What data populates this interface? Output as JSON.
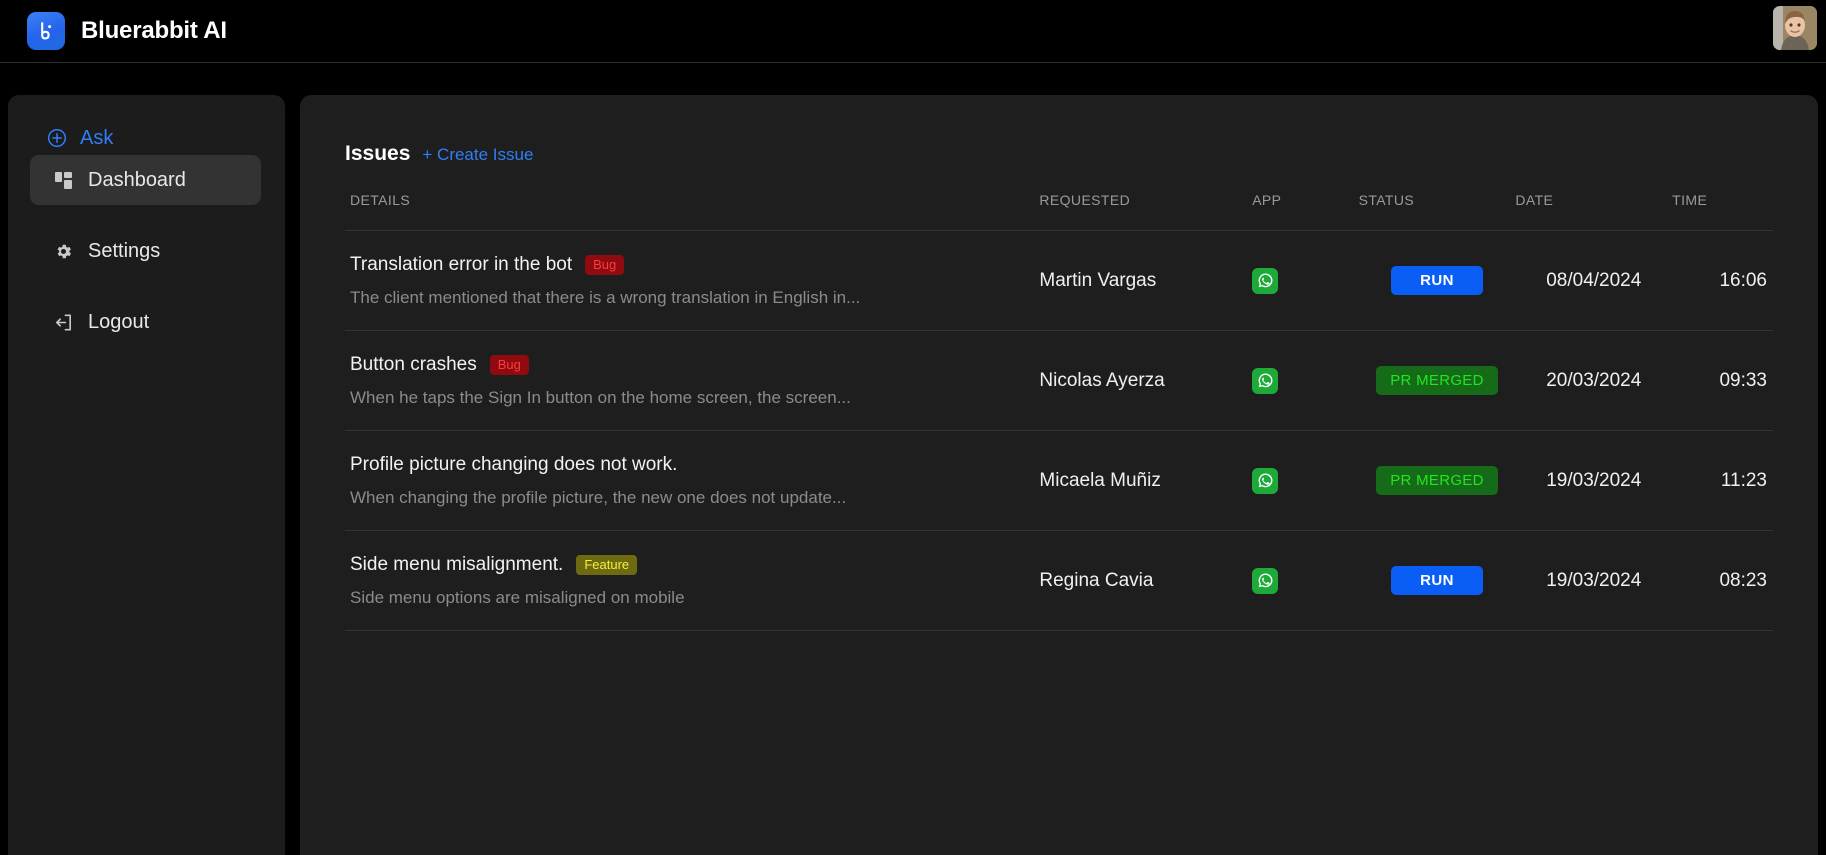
{
  "app": {
    "brand_name": "Bluerabbit AI",
    "logo_icon": "bluerabbit-logo-icon",
    "avatar_icon": "user-avatar"
  },
  "sidebar": {
    "ask": {
      "label": "Ask",
      "icon": "plus-circle-icon"
    },
    "items": [
      {
        "label": "Dashboard",
        "icon": "dashboard-grid-icon",
        "active": true
      },
      {
        "label": "Settings",
        "icon": "gear-icon",
        "active": false
      },
      {
        "label": "Logout",
        "icon": "logout-arrow-icon",
        "active": false
      }
    ]
  },
  "main": {
    "title": "Issues",
    "create_issue_label": "+ Create Issue",
    "columns": {
      "details": "DETAILS",
      "requested": "REQUESTED",
      "app": "APP",
      "status": "STATUS",
      "date": "DATE",
      "time": "TIME"
    },
    "rows": [
      {
        "title": "Translation error in the bot",
        "badge": "Bug",
        "badge_type": "bug",
        "description": "The client mentioned that there is a wrong translation in English in...",
        "requested": "Martin Vargas",
        "app": "whatsapp-icon",
        "status": "RUN",
        "status_type": "run",
        "date": "08/04/2024",
        "time": "16:06"
      },
      {
        "title": "Button crashes",
        "badge": "Bug",
        "badge_type": "bug",
        "description": "When he taps the Sign In button on the home screen, the screen...",
        "requested": "Nicolas Ayerza",
        "app": "whatsapp-icon",
        "status": "PR MERGED",
        "status_type": "merged",
        "date": "20/03/2024",
        "time": "09:33"
      },
      {
        "title": "Profile picture changing does not work.",
        "badge": "",
        "badge_type": "none",
        "description": "When changing the profile picture, the new one does not update...",
        "requested": "Micaela Muñiz",
        "app": "whatsapp-icon",
        "status": "PR MERGED",
        "status_type": "merged",
        "date": "19/03/2024",
        "time": "11:23"
      },
      {
        "title": "Side menu misalignment.",
        "badge": "Feature",
        "badge_type": "feature",
        "description": "Side menu options are misaligned on mobile",
        "requested": "Regina Cavia",
        "app": "whatsapp-icon",
        "status": "RUN",
        "status_type": "run",
        "date": "19/03/2024",
        "time": "08:23"
      }
    ]
  },
  "colors": {
    "accent_blue": "#2f7ef6",
    "run_blue": "#0b5ef5",
    "bug_red": "#ff3b3b",
    "merged_green": "#22e522",
    "feature_yellow": "#f6ef3c",
    "whatsapp_green": "#1eaa39",
    "panel_bg": "#1e1e1e",
    "sidebar_bg": "#1c1c1c",
    "page_bg": "#000000"
  }
}
